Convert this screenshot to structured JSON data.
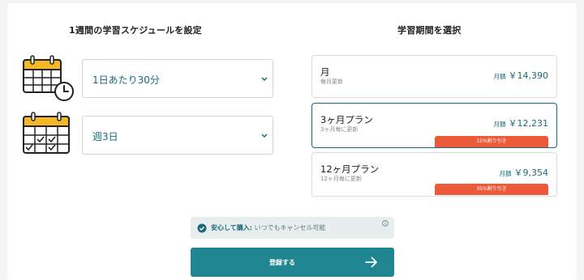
{
  "schedule": {
    "heading": "1週間の学習スケジュールを設定",
    "per_day": {
      "value": "1日あたり30分",
      "icon": "calendar-clock-icon"
    },
    "per_week": {
      "value": "週3日",
      "icon": "calendar-check-icon"
    }
  },
  "period": {
    "heading": "学習期間を選択",
    "plans": [
      {
        "name": "月",
        "sub": "毎月更新",
        "price_label": "月額",
        "price": "￥14,390",
        "badge": ""
      },
      {
        "name": "3ヶ月プラン",
        "sub": "3ヶ月毎に更新",
        "price_label": "月額",
        "price": "￥12,231",
        "badge": "15%割り引き"
      },
      {
        "name": "12ヶ月プラン",
        "sub": "12ヶ月毎に更新",
        "price_label": "月額",
        "price": "￥9,354",
        "badge": "35%割り引き"
      }
    ]
  },
  "notice": {
    "strong": "安心して購入:",
    "rest": " いつでもキャンセル可能"
  },
  "cta": {
    "label": "登録する"
  },
  "colors": {
    "accent": "#1b6a78",
    "button": "#1f8590",
    "badge": "#ec5a39",
    "calendar_header": "#f6b824"
  }
}
